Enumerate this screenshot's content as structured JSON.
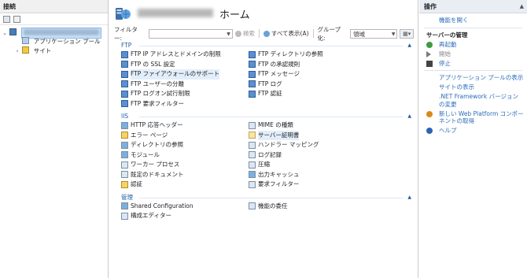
{
  "connections": {
    "header": "接続",
    "tree": [
      {
        "label": "",
        "expander": "⌄",
        "level": 0,
        "selected": true
      },
      {
        "label": "アプリケーション プール",
        "expander": "",
        "level": 1
      },
      {
        "label": "サイト",
        "expander": "›",
        "level": 1
      }
    ]
  },
  "center": {
    "title": "ホーム",
    "filter_label": "フィルター:",
    "toolbar": {
      "search": "検索",
      "show_all": "すべて表示(A)",
      "group_by_label": "グループ化:",
      "group_by_value": "領域"
    },
    "groups": [
      {
        "name": "FTP",
        "items": [
          "FTP IP アドレスとドメインの制限",
          "FTP ディレクトリの参照",
          "FTP の SSL 設定",
          "FTP の承認規則",
          "FTP ファイアウォールのサポート",
          "FTP メッセージ",
          "FTP ユーザーの分離",
          "FTP ログ",
          "FTP ログオン試行制限",
          "FTP 認証",
          "FTP 要求フィルター",
          ""
        ]
      },
      {
        "name": "IIS",
        "items": [
          "HTTP 応答ヘッダー",
          "MIME の種類",
          "エラー ページ",
          "サーバー証明書",
          "ディレクトリの参照",
          "ハンドラー マッピング",
          "モジュール",
          "ログ記録",
          "ワーカー プロセス",
          "圧縮",
          "既定のドキュメント",
          "出力キャッシュ",
          "認証",
          "要求フィルター"
        ]
      },
      {
        "name": "管理",
        "items": [
          "Shared Configuration",
          "機能の委任",
          "構成エディター",
          ""
        ]
      }
    ]
  },
  "actions": {
    "header": "操作",
    "open_feature": "機能を開く",
    "server_section": "サーバーの管理",
    "restart": "再起動",
    "start": "開始",
    "stop": "停止",
    "view_app_pools": "アプリケーション プールの表示",
    "view_sites": "サイトの表示",
    "dotnet_version": ".NET Framework バージョンの変更",
    "web_platform": "新しい Web Platform コンポーネントの取得",
    "help": "ヘルプ"
  }
}
